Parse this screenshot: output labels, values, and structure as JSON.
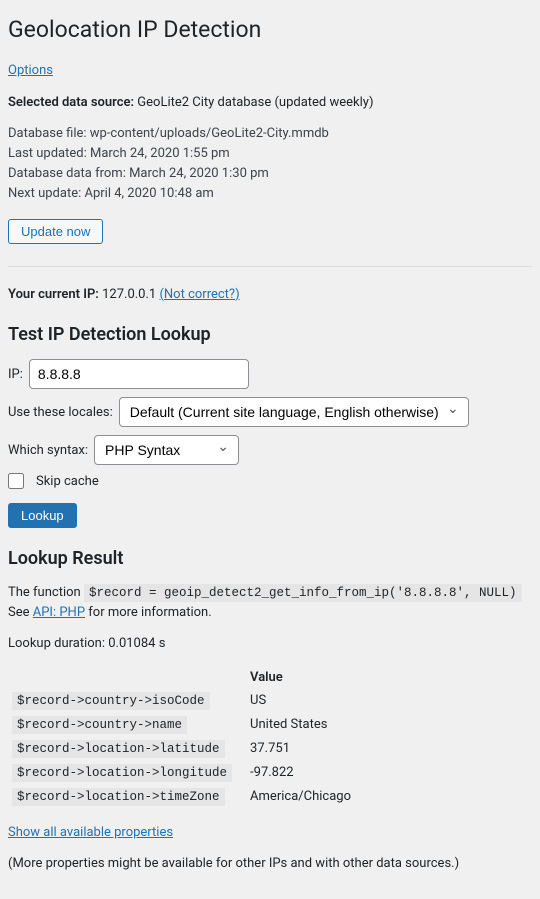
{
  "page": {
    "title": "Geolocation IP Detection",
    "options_link": "Options"
  },
  "datasource": {
    "label": "Selected data source:",
    "value": "GeoLite2 City database (updated weekly)",
    "lines": [
      "Database file: wp-content/uploads/GeoLite2-City.mmdb",
      "Last updated: March 24, 2020 1:55 pm",
      "Database data from: March 24, 2020 1:30 pm",
      "Next update: April 4, 2020 10:48 am"
    ],
    "update_button": "Update now"
  },
  "current_ip": {
    "label": "Your current IP:",
    "value": "127.0.0.1",
    "not_correct": "(Not correct?)"
  },
  "lookup_form": {
    "heading": "Test IP Detection Lookup",
    "ip_label": "IP:",
    "ip_value": "8.8.8.8",
    "locales_label": "Use these locales:",
    "locales_value": "Default (Current site language, English otherwise)",
    "syntax_label": "Which syntax:",
    "syntax_value": "PHP Syntax",
    "skip_cache": "Skip cache",
    "lookup_button": "Lookup"
  },
  "result": {
    "heading": "Lookup Result",
    "function_prefix": "The function",
    "function_code": "$record = geoip_detect2_get_info_from_ip('8.8.8.8', NULL)",
    "see_prefix": "See",
    "api_link": "API: PHP",
    "see_suffix": "for more information.",
    "duration": "Lookup duration: 0.01084 s",
    "value_header": "Value",
    "rows": [
      {
        "key": "$record->country->isoCode",
        "val": "US"
      },
      {
        "key": "$record->country->name",
        "val": "United States"
      },
      {
        "key": "$record->location->latitude",
        "val": "37.751"
      },
      {
        "key": "$record->location->longitude",
        "val": "-97.822"
      },
      {
        "key": "$record->location->timeZone",
        "val": "America/Chicago"
      }
    ],
    "show_all": "Show all available properties",
    "more_note": "(More properties might be available for other IPs and with other data sources.)"
  }
}
